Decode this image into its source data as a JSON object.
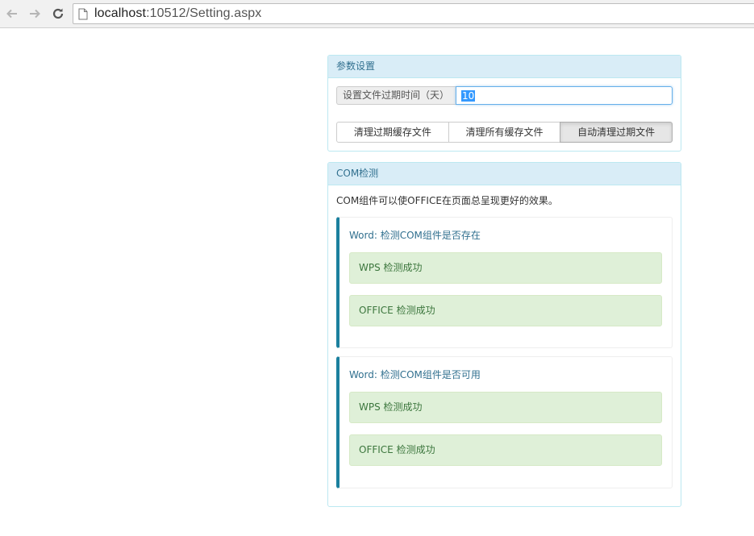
{
  "browser": {
    "url_host": "localhost",
    "url_rest": ":10512/Setting.aspx"
  },
  "settings_panel": {
    "title": "参数设置",
    "expire_label": "设置文件过期时间（天）",
    "expire_value": "10",
    "buttons": [
      {
        "label": "清理过期缓存文件",
        "active": false
      },
      {
        "label": "清理所有缓存文件",
        "active": false
      },
      {
        "label": "自动清理过期文件",
        "active": true
      }
    ]
  },
  "com_panel": {
    "title": "COM检测",
    "description": "COM组件可以使OFFICE在页面总呈现更好的效果。",
    "checks": [
      {
        "title": "Word: 检测COM组件是否存在",
        "results": [
          "WPS 检测成功",
          "OFFICE 检测成功"
        ]
      },
      {
        "title": "Word: 检测COM组件是否可用",
        "results": [
          "WPS 检测成功",
          "OFFICE 检测成功"
        ]
      }
    ]
  },
  "colors": {
    "panel_heading_bg": "#d9edf7",
    "panel_heading_text": "#31708f",
    "success_bg": "#dff0d8",
    "success_text": "#3c763d",
    "callout_accent": "#1b809e"
  }
}
